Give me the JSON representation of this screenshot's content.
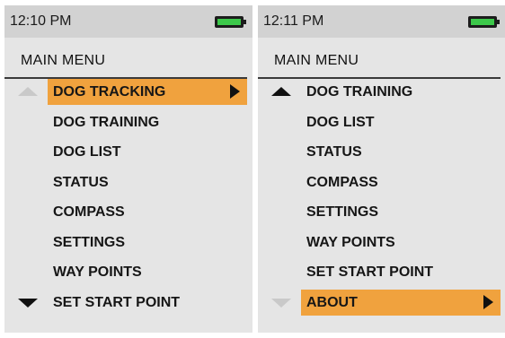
{
  "screens": [
    {
      "time": "12:10 PM",
      "menu_title": "MAIN MENU",
      "items": [
        {
          "label": "DOG TRACKING",
          "selected": true
        },
        {
          "label": "DOG TRAINING"
        },
        {
          "label": "DOG LIST"
        },
        {
          "label": "STATUS"
        },
        {
          "label": "COMPASS"
        },
        {
          "label": "SETTINGS"
        },
        {
          "label": "WAY POINTS"
        },
        {
          "label": "SET START POINT"
        }
      ]
    },
    {
      "time": "12:11 PM",
      "menu_title": "MAIN MENU",
      "items": [
        {
          "label": "DOG TRAINING"
        },
        {
          "label": "DOG LIST"
        },
        {
          "label": "STATUS"
        },
        {
          "label": "COMPASS"
        },
        {
          "label": "SETTINGS"
        },
        {
          "label": "WAY POINTS"
        },
        {
          "label": "SET START POINT"
        },
        {
          "label": "ABOUT",
          "selected": true
        }
      ]
    }
  ],
  "colors": {
    "selection": "#f0a23e",
    "battery": "#3cc84a"
  },
  "icons": [
    "battery-icon",
    "scroll-up-arrow-icon",
    "scroll-down-arrow-icon",
    "submenu-arrow-icon"
  ]
}
